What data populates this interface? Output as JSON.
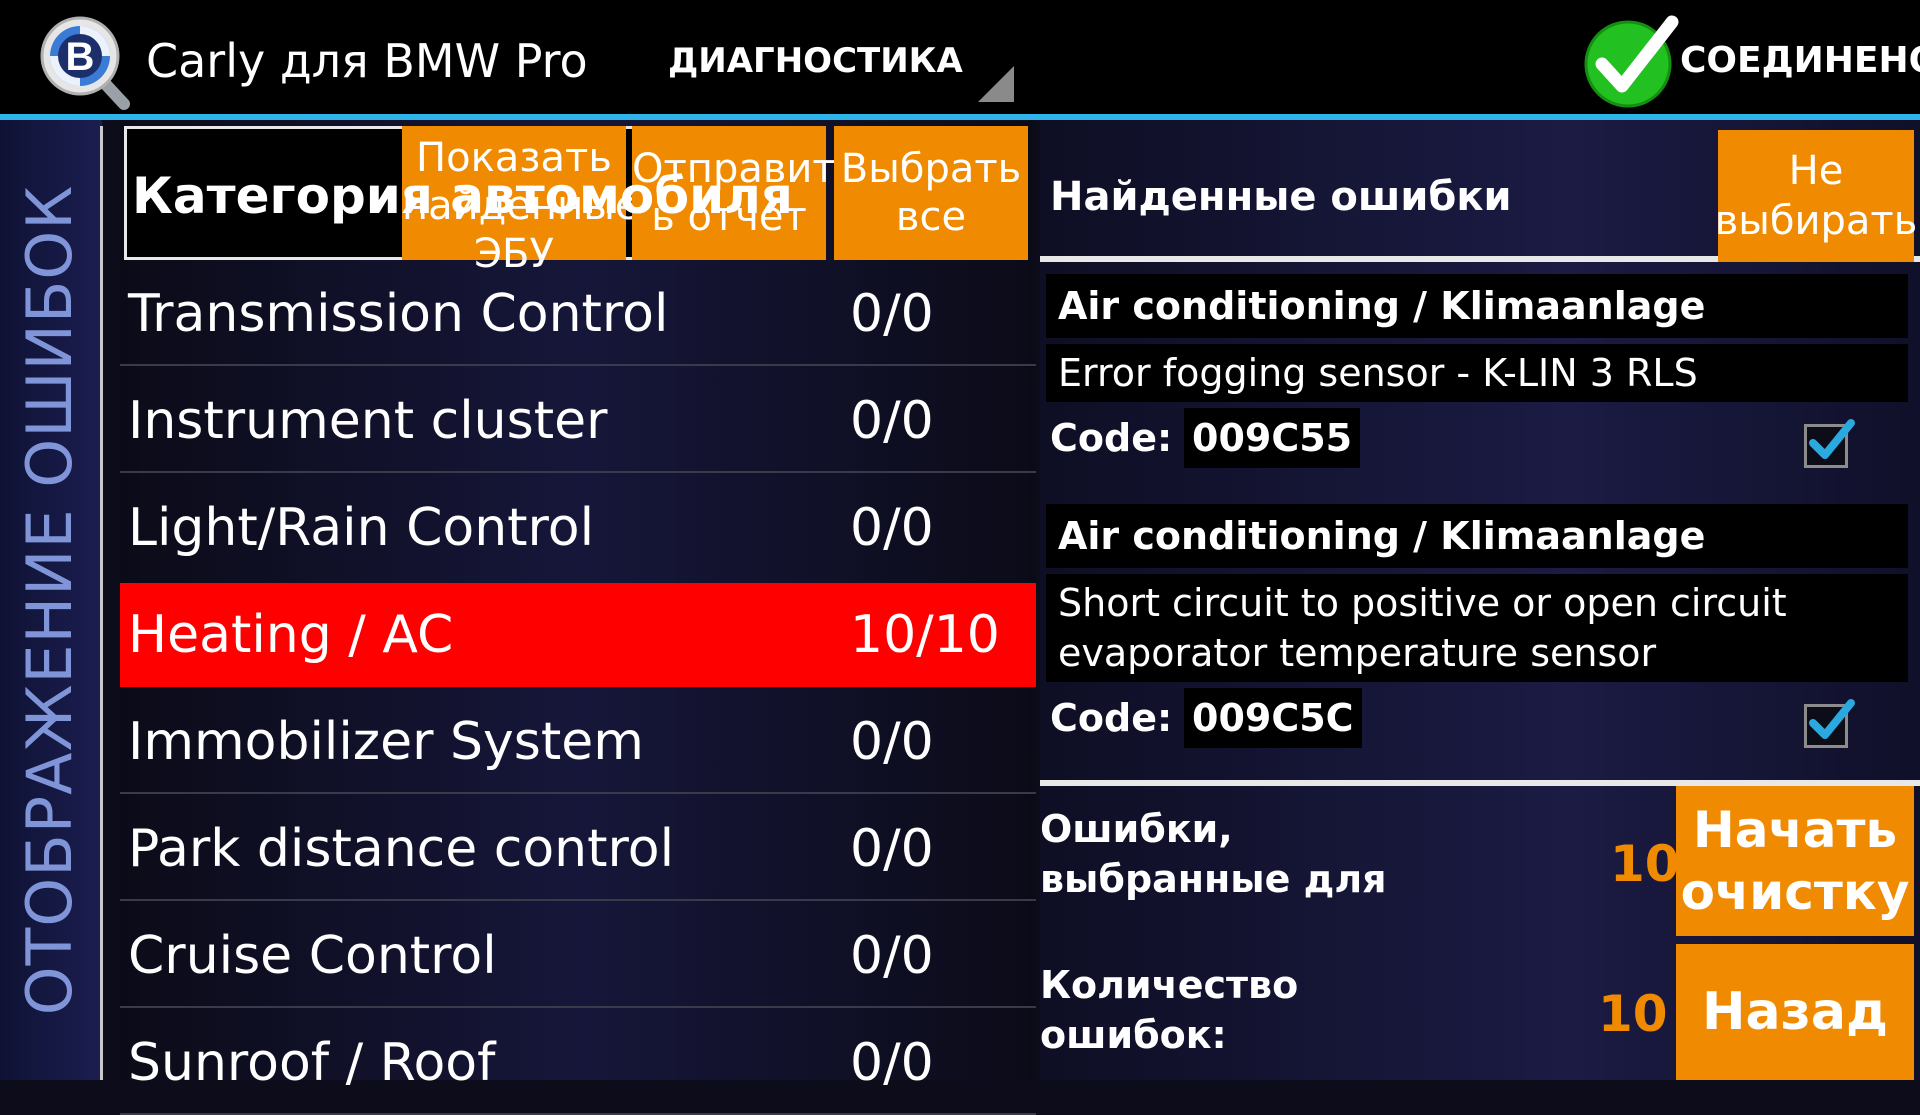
{
  "topbar": {
    "app_title": "Carly для BMW Pro",
    "logo_letter": "B",
    "section_label": "ДИАГНОСТИКА",
    "status_text": "СОЕДИНЕНО"
  },
  "sidebar": {
    "vertical_title": "ОТОБРАЖЕНИЕ ОШИБОК"
  },
  "left_panel": {
    "category_title": "Категория автомобиля",
    "buttons": {
      "show_ecus": "Показать найденные ЭБУ",
      "send_report": "Отправит ь отчет",
      "select_all": "Выбрать все"
    },
    "rows": [
      {
        "name": "Transmission Control",
        "count": "0/0"
      },
      {
        "name": "Instrument cluster",
        "count": "0/0"
      },
      {
        "name": "Light/Rain Control",
        "count": "0/0"
      },
      {
        "name": "Heating / AC",
        "count": "10/10"
      },
      {
        "name": "Immobilizer System",
        "count": "0/0"
      },
      {
        "name": "Park distance control",
        "count": "0/0"
      },
      {
        "name": "Cruise Control",
        "count": "0/0"
      },
      {
        "name": "Sunroof / Roof",
        "count": "0/0"
      }
    ],
    "selected_row_index": 3
  },
  "right_panel": {
    "found_title": "Найденные ошибки",
    "deselect_button": "Не выбирать",
    "errors": [
      {
        "module": "Air conditioning / Klimaanlage",
        "description": "Error fogging sensor - K-LIN 3 RLS",
        "code_label": "Code:",
        "code": "009C55",
        "checked": true
      },
      {
        "module": "Air conditioning / Klimaanlage",
        "description": "Short circuit to positive or open circuit evaporator temperature sensor",
        "code_label": "Code:",
        "code": "009C5C",
        "checked": true
      }
    ],
    "selected_for_label": "Ошибки, выбранные для",
    "selected_for_value": "10",
    "error_count_label": "Количество ошибок:",
    "error_count_value": "10",
    "start_clear_button": "Начать очистку",
    "back_button": "Назад"
  },
  "colors": {
    "accent_orange": "#f08a00",
    "selected_red": "#ff0000",
    "topbar_line_blue": "#2fb4e9",
    "status_green": "#22c020",
    "check_blue": "#2aa8e0"
  },
  "icons": {
    "logo": "bmw-logo-magnifier-icon",
    "status": "connected-checkmark-icon",
    "dropdown": "dropdown-triangle-icon",
    "checkbox": "checkbox-checked-icon"
  }
}
